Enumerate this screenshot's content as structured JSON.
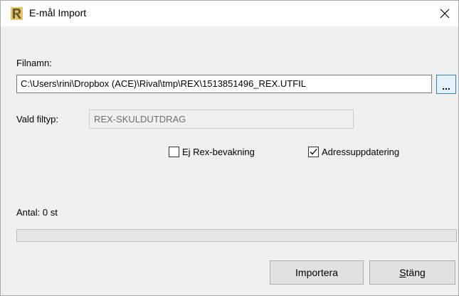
{
  "window": {
    "title": "E-mål Import",
    "close_glyph": "✕"
  },
  "form": {
    "filename_label": "Filnamn:",
    "filename_value": "C:\\Users\\rini\\Dropbox (ACE)\\Rival\\tmp\\REX\\1513851496_REX.UTFIL",
    "browse_label": "...",
    "filetype_label": "Vald filtyp:",
    "filetype_value": "REX-SKULDUTDRAG"
  },
  "options": {
    "ej_rex": {
      "label": "Ej Rex-bevakning",
      "checked": false
    },
    "adress": {
      "label": "Adressuppdatering",
      "checked": true
    }
  },
  "status": {
    "count_label": "Antal: 0 st",
    "progress": 0
  },
  "buttons": {
    "import_label": "Importera",
    "close_label_rest": "täng",
    "close_label_mnemonic": "S"
  },
  "colors": {
    "accent_border": "#3c7fb1",
    "app_icon_dark": "#6b5a2c",
    "app_icon_light": "#e2c66b"
  }
}
